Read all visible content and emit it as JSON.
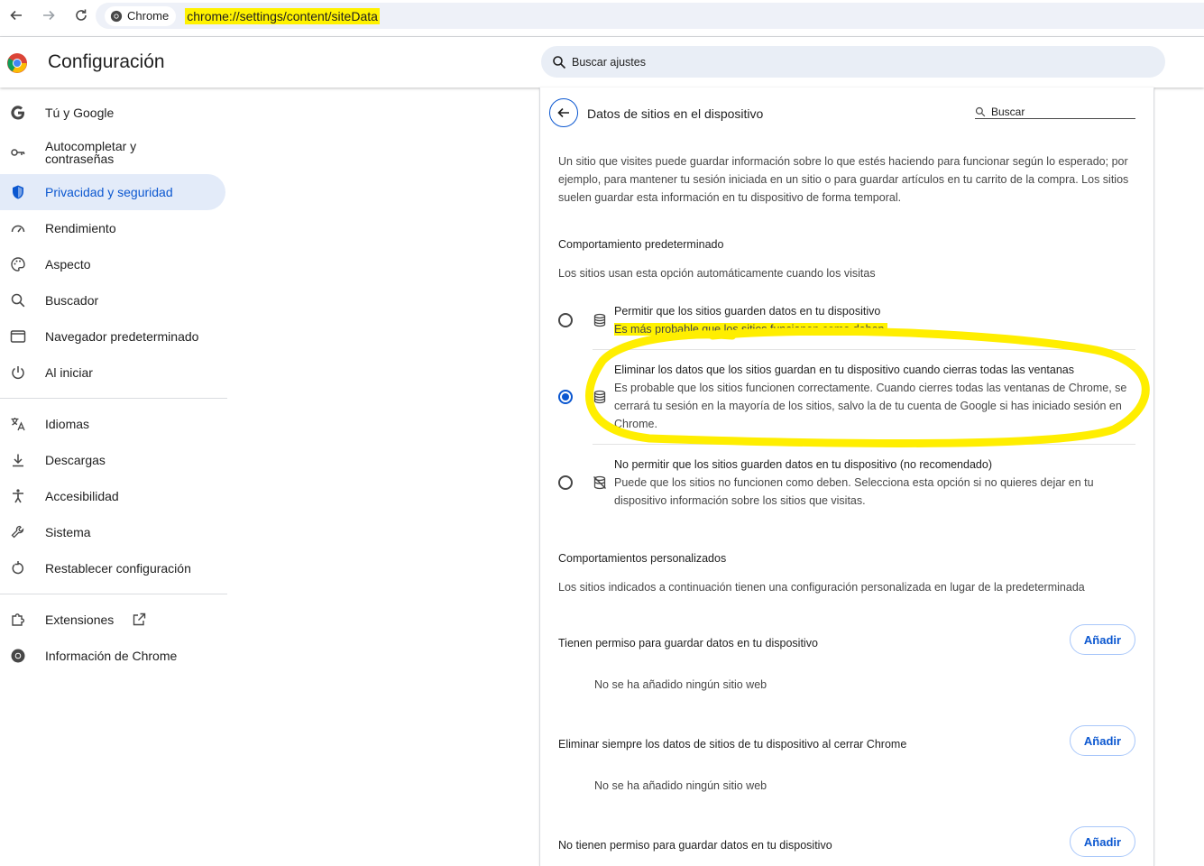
{
  "browser": {
    "chip_label": "Chrome",
    "url": "chrome://settings/content/siteData"
  },
  "header": {
    "title": "Configuración",
    "search_placeholder": "Buscar ajustes"
  },
  "sidebar": {
    "items": [
      {
        "label": "Tú y Google",
        "icon": "google-g-icon"
      },
      {
        "label": "Autocompletar y contraseñas",
        "icon": "key-icon"
      },
      {
        "label": "Privacidad y seguridad",
        "icon": "shield-icon",
        "active": true
      },
      {
        "label": "Rendimiento",
        "icon": "speedometer-icon"
      },
      {
        "label": "Aspecto",
        "icon": "palette-icon"
      },
      {
        "label": "Buscador",
        "icon": "search-icon"
      },
      {
        "label": "Navegador predeterminado",
        "icon": "browser-window-icon"
      },
      {
        "label": "Al iniciar",
        "icon": "power-icon"
      },
      {
        "label": "Idiomas",
        "icon": "translate-icon"
      },
      {
        "label": "Descargas",
        "icon": "download-icon"
      },
      {
        "label": "Accesibilidad",
        "icon": "accessibility-icon"
      },
      {
        "label": "Sistema",
        "icon": "wrench-icon"
      },
      {
        "label": "Restablecer configuración",
        "icon": "reset-icon"
      },
      {
        "label": "Extensiones",
        "icon": "puzzle-icon"
      },
      {
        "label": "Información de Chrome",
        "icon": "chrome-icon"
      }
    ]
  },
  "page": {
    "title": "Datos de sitios en el dispositivo",
    "search_placeholder": "Buscar",
    "intro": "Un sitio que visites puede guardar información sobre lo que estés haciendo para funcionar según lo esperado; por ejemplo, para mantener tu sesión iniciada en un sitio o para guardar artículos en tu carrito de la compra. Los sitios suelen guardar esta información en tu dispositivo de forma temporal.",
    "default_heading": "Comportamiento predeterminado",
    "default_desc": "Los sitios usan esta opción automáticamente cuando los visitas",
    "options": [
      {
        "title": "Permitir que los sitios guarden datos en tu dispositivo",
        "desc": "Es más probable que los sitios funcionen como deben.",
        "checked": false
      },
      {
        "title": "Eliminar los datos que los sitios guardan en tu dispositivo cuando cierras todas las ventanas",
        "desc": "Es probable que los sitios funcionen correctamente. Cuando cierres todas las ventanas de Chrome, se cerrará tu sesión en la mayoría de los sitios, salvo la de tu cuenta de Google si has iniciado sesión en Chrome.",
        "checked": true
      },
      {
        "title": "No permitir que los sitios guarden datos en tu dispositivo (no recomendado)",
        "desc": "Puede que los sitios no funcionen como deben. Selecciona esta opción si no quieres dejar en tu dispositivo información sobre los sitios que visitas.",
        "checked": false
      }
    ],
    "custom_heading": "Comportamientos personalizados",
    "custom_desc": "Los sitios indicados a continuación tienen una configuración personalizada en lugar de la predeterminada",
    "lists": [
      {
        "label": "Tienen permiso para guardar datos en tu dispositivo",
        "button": "Añadir",
        "empty": "No se ha añadido ningún sitio web"
      },
      {
        "label": "Eliminar siempre los datos de sitios de tu dispositivo al cerrar Chrome",
        "button": "Añadir",
        "empty": "No se ha añadido ningún sitio web"
      },
      {
        "label": "No tienen permiso para guardar datos en tu dispositivo",
        "button": "Añadir"
      }
    ]
  },
  "colors": {
    "accent": "#0b57d0",
    "highlight": "#fff200",
    "annotation": "#ffee00"
  }
}
